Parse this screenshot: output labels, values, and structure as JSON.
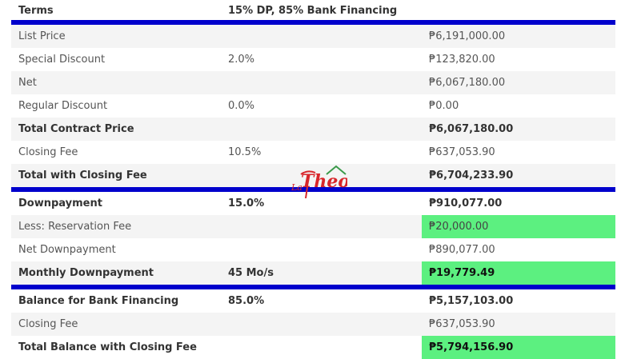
{
  "terms": {
    "label": "Terms",
    "value": "15% DP, 85% Bank Financing"
  },
  "section1": [
    {
      "label": "List Price",
      "rate": "",
      "amount": "₱6,191,000.00",
      "bold": false
    },
    {
      "label": "Special Discount",
      "rate": "2.0%",
      "amount": "₱123,820.00",
      "bold": false
    },
    {
      "label": "Net",
      "rate": "",
      "amount": "₱6,067,180.00",
      "bold": false
    },
    {
      "label": "Regular Discount",
      "rate": "0.0%",
      "amount": "₱0.00",
      "bold": false
    },
    {
      "label": "Total Contract Price",
      "rate": "",
      "amount": "₱6,067,180.00",
      "bold": true
    },
    {
      "label": "Closing Fee",
      "rate": "10.5%",
      "amount": "₱637,053.90",
      "bold": false
    },
    {
      "label": "Total with Closing Fee",
      "rate": "",
      "amount": "₱6,704,233.90",
      "bold": true
    }
  ],
  "section2": [
    {
      "label": "Downpayment",
      "rate": "15.0%",
      "amount": "₱910,077.00",
      "bold": true
    },
    {
      "label": "Less: Reservation Fee",
      "rate": "",
      "amount": "₱20,000.00",
      "bold": false,
      "highlight": true
    },
    {
      "label": "Net Downpayment",
      "rate": "",
      "amount": "₱890,077.00",
      "bold": false
    },
    {
      "label": "Monthly Downpayment",
      "rate": "45 Mo/s",
      "amount": "₱19,779.49",
      "bold": true,
      "highlight": true
    }
  ],
  "section3": [
    {
      "label": "Balance for Bank Financing",
      "rate": "85.0%",
      "amount": "₱5,157,103.00",
      "bold": true
    },
    {
      "label": "Closing Fee",
      "rate": "",
      "amount": "₱637,053.90",
      "bold": false
    },
    {
      "label": "Total Balance with Closing Fee",
      "rate": "",
      "amount": "₱5,794,156.90",
      "bold": true,
      "highlight": true
    }
  ],
  "colors": {
    "separator": "#0000cc",
    "highlight": "#5cf080",
    "logo_red": "#d8262b",
    "logo_green": "#3a9a4a"
  },
  "logo": {
    "prefix": "La",
    "word": "Theoz",
    "icon": "house-roof-icon"
  }
}
